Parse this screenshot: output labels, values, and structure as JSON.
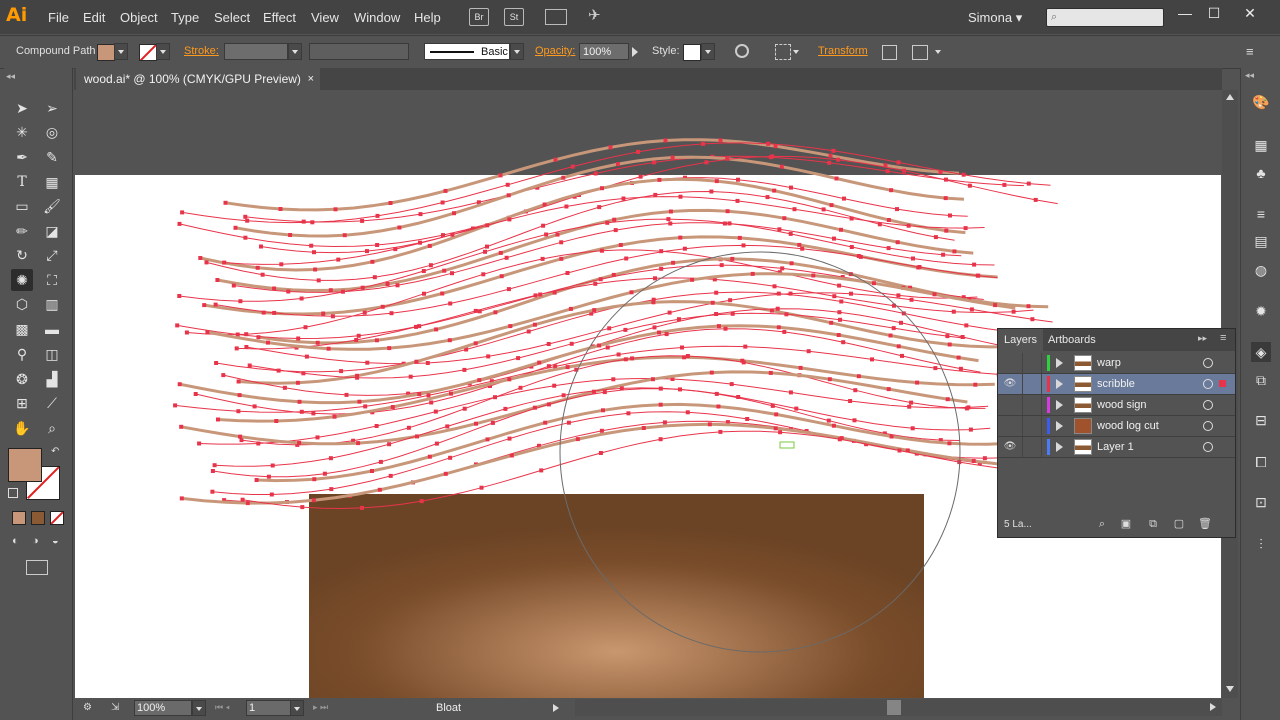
{
  "app": {
    "logo": "Ai"
  },
  "menu": {
    "items": [
      "File",
      "Edit",
      "Object",
      "Type",
      "Select",
      "Effect",
      "View",
      "Window",
      "Help"
    ]
  },
  "menubar_icons": {
    "bridge": "Br",
    "stock": "St"
  },
  "user": {
    "name": "Simona"
  },
  "window_controls": {
    "minimize": "—",
    "maximize": "☐",
    "close": "✕"
  },
  "control_bar": {
    "selection_type": "Compound Path",
    "fill_color": "#c8977a",
    "stroke_label": "Stroke:",
    "brush_label": "Basic",
    "opacity_label": "Opacity:",
    "opacity_value": "100%",
    "style_label": "Style:",
    "transform_label": "Transform"
  },
  "document": {
    "tab_title": "wood.ai* @ 100% (CMYK/GPU Preview)",
    "close": "×"
  },
  "toolbox": {
    "fill_color": "#c8977a",
    "stroke_color": "#ffffff"
  },
  "status": {
    "zoom": "100%",
    "artboard": "1",
    "tool": "Bloat"
  },
  "layers_panel": {
    "tabs": [
      "Layers",
      "Artboards"
    ],
    "layers": [
      {
        "name": "warp",
        "color": "#2fd13d",
        "visible": false,
        "selected": false
      },
      {
        "name": "scribble",
        "color": "#e8344a",
        "visible": true,
        "selected": true
      },
      {
        "name": "wood sign",
        "color": "#d63be0",
        "visible": false,
        "selected": false
      },
      {
        "name": "wood log cut",
        "color": "#3a5cf0",
        "visible": false,
        "selected": false
      },
      {
        "name": "Layer 1",
        "color": "#4a7df5",
        "visible": true,
        "selected": false
      }
    ],
    "count_label": "5 La..."
  },
  "colors": {
    "path_highlight": "#e8344a",
    "wood_dark": "#6b4425",
    "wood_light": "#c9976f",
    "scribble_fill": "#c8977a"
  }
}
